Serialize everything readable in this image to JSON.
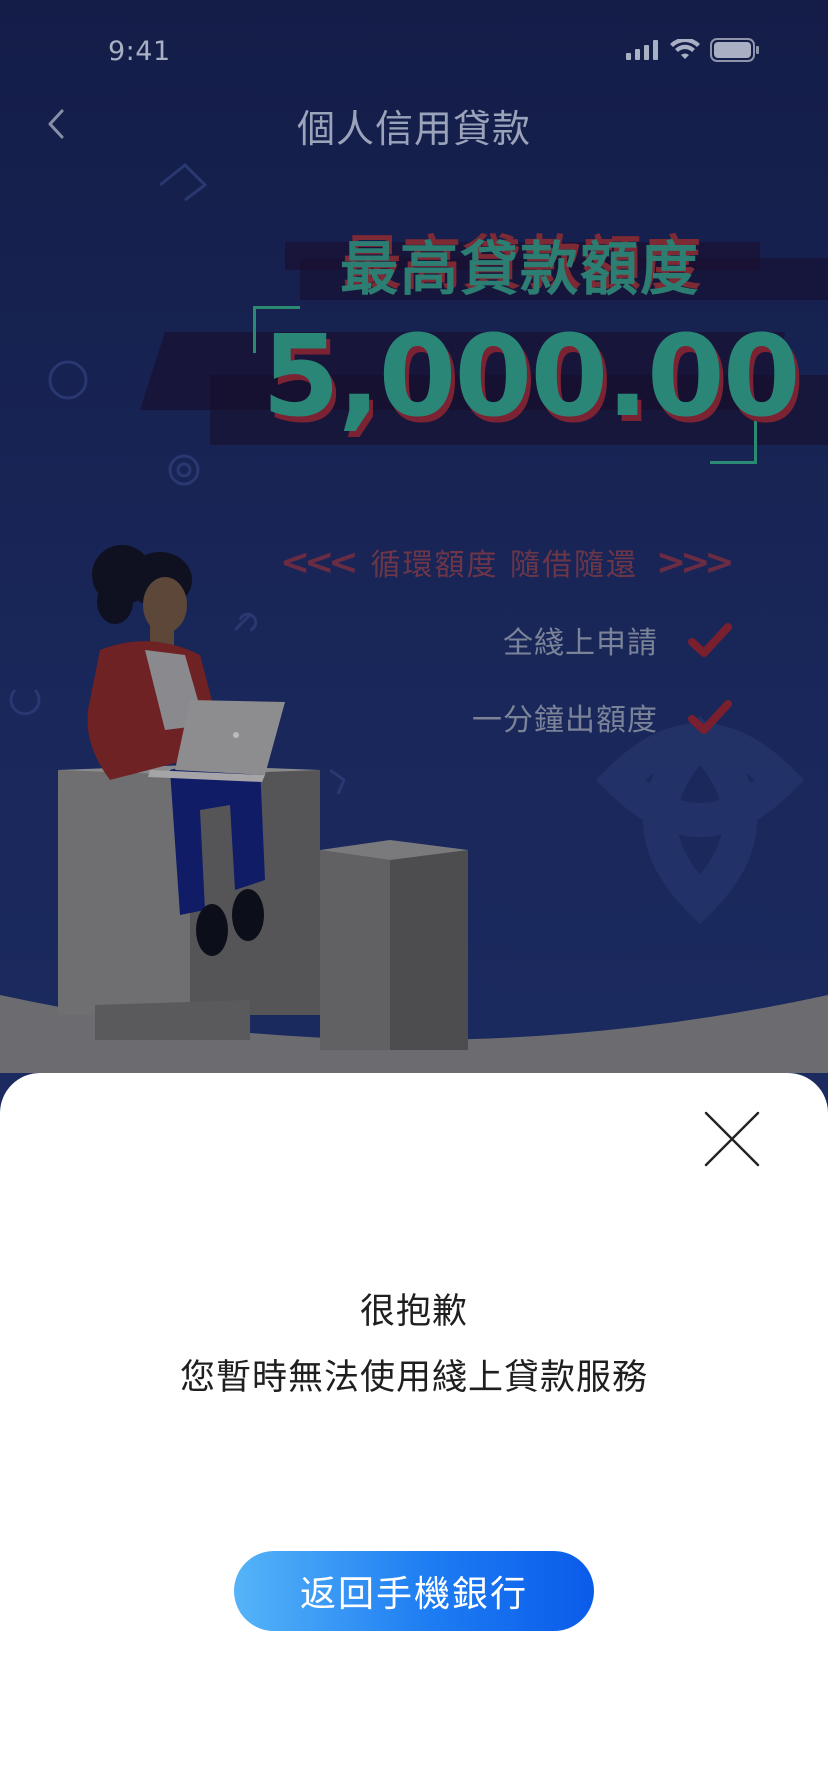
{
  "status_bar": {
    "time": "9:41"
  },
  "nav": {
    "title": "個人信用貸款"
  },
  "hero": {
    "title": "最高貸款額度",
    "amount": "5,000.00",
    "feature_main": {
      "left_chevrons": "<<<",
      "text": "循環額度  隨借隨還",
      "right_chevrons": ">>>"
    },
    "features": [
      {
        "label": "全綫上申請"
      },
      {
        "label": "一分鐘出額度"
      }
    ]
  },
  "modal": {
    "message_line1": "很抱歉",
    "message_line2": "您暫時無法使用綫上貸款服務",
    "button_label": "返回手機銀行"
  },
  "colors": {
    "accent_green": "#2a8676",
    "accent_red": "#7b2332",
    "button_start": "#55b4f8",
    "button_end": "#0a5bea"
  }
}
